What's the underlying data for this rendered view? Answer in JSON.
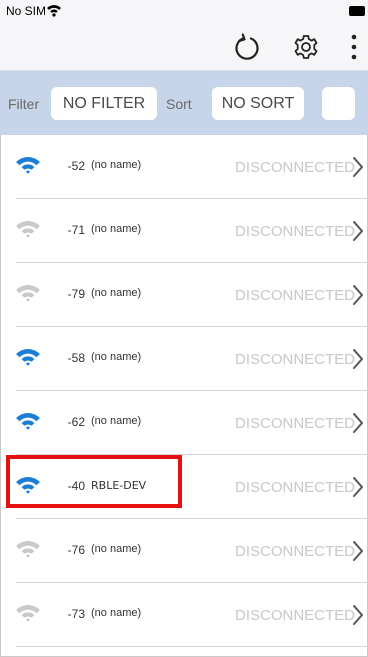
{
  "status_bar": {
    "carrier": "No SIM"
  },
  "toolbar": {
    "icons": [
      "refresh-icon",
      "gear-icon",
      "more-vertical-icon"
    ]
  },
  "filter_bar": {
    "filter_label": "Filter",
    "filter_value": "NO FILTER",
    "sort_label": "Sort",
    "sort_value": "NO SORT"
  },
  "devices": [
    {
      "rssi": "-52",
      "name": "(no name)",
      "status": "DISCONNECTED",
      "signal": "strong"
    },
    {
      "rssi": "-71",
      "name": "(no name)",
      "status": "DISCONNECTED",
      "signal": "weak"
    },
    {
      "rssi": "-79",
      "name": "(no name)",
      "status": "DISCONNECTED",
      "signal": "weak"
    },
    {
      "rssi": "-58",
      "name": "(no name)",
      "status": "DISCONNECTED",
      "signal": "strong"
    },
    {
      "rssi": "-62",
      "name": "(no name)",
      "status": "DISCONNECTED",
      "signal": "strong"
    },
    {
      "rssi": "-40",
      "name": "RBLE-DEV",
      "status": "DISCONNECTED",
      "signal": "strong"
    },
    {
      "rssi": "-76",
      "name": "(no name)",
      "status": "DISCONNECTED",
      "signal": "weak"
    },
    {
      "rssi": "-73",
      "name": "(no name)",
      "status": "DISCONNECTED",
      "signal": "weak"
    }
  ],
  "colors": {
    "accent": "#1a7fd9",
    "signal_weak": "#c9c9c9",
    "filter_bar_bg": "#c7d5ea",
    "highlight": "#e61010"
  }
}
